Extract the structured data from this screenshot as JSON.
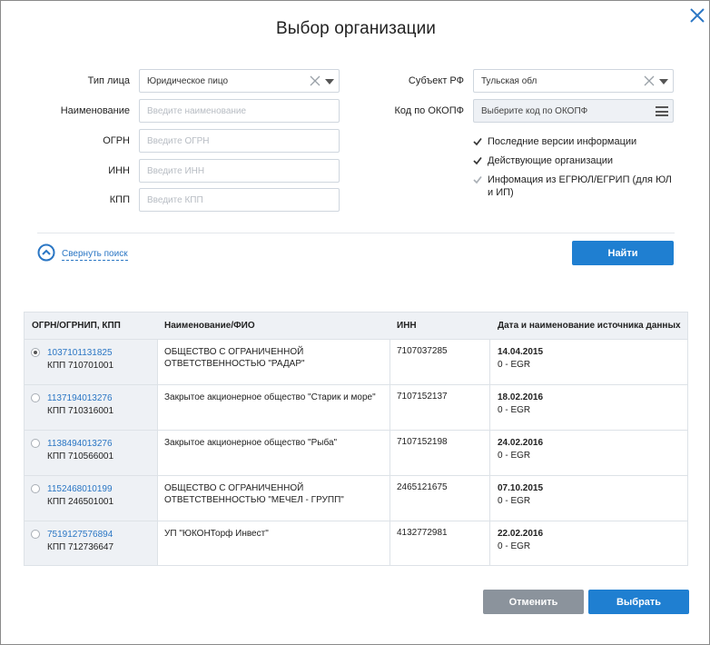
{
  "dialog": {
    "title": "Выбор организации"
  },
  "form": {
    "entity_type": {
      "label": "Тип лица",
      "value": "Юридическое пицо"
    },
    "name": {
      "label": "Наименование",
      "placeholder": "Введите наименование"
    },
    "ogrn": {
      "label": "ОГРН",
      "placeholder": "Введите ОГРН"
    },
    "inn": {
      "label": "ИНН",
      "placeholder": "Введите ИНН"
    },
    "kpp": {
      "label": "КПП",
      "placeholder": "Введите КПП"
    },
    "region": {
      "label": "Субъект РФ",
      "value": "Тульская обл"
    },
    "okopf": {
      "label": "Код по ОКОПФ",
      "placeholder": "Выберите код по ОКОПФ"
    },
    "checkboxes": [
      {
        "label": "Последние версии информации",
        "checked": true,
        "disabled": false
      },
      {
        "label": "Действующие организации",
        "checked": true,
        "disabled": false
      },
      {
        "label": "Инфомация из ЕГРЮЛ/ЕГРИП (для ЮЛ и ИП)",
        "checked": true,
        "disabled": true
      }
    ]
  },
  "actions": {
    "collapse_label": "Свернуть поиск",
    "find_label": "Найти",
    "cancel_label": "Отменить",
    "select_label": "Выбрать"
  },
  "table": {
    "headers": [
      "ОГРН/ОГРНИП, КПП",
      "Наименование/ФИО",
      "ИНН",
      "Дата и наименование источника данных"
    ],
    "rows": [
      {
        "ogrn": "1037101131825",
        "kpp": "КПП 710701001",
        "name": "ОБЩЕСТВО С ОГРАНИЧЕННОЙ ОТВЕТСТВЕННОСТЬЮ \"РАДАР\"",
        "inn": "7107037285",
        "date": "14.04.2015",
        "source": "0 - EGR",
        "selected": true
      },
      {
        "ogrn": "1137194013276",
        "kpp": "КПП 710316001",
        "name": "Закрытое акционерное общество \"Старик и море\"",
        "inn": "7107152137",
        "date": "18.02.2016",
        "source": "0 - EGR",
        "selected": false
      },
      {
        "ogrn": "1138494013276",
        "kpp": "КПП 710566001",
        "name": "Закрытое акционерное общество \"Рыба\"",
        "inn": "7107152198",
        "date": "24.02.2016",
        "source": "0 - EGR",
        "selected": false
      },
      {
        "ogrn": "1152468010199",
        "kpp": "КПП 246501001",
        "name": "ОБЩЕСТВО С ОГРАНИЧЕННОЙ ОТВЕТСТВЕННОСТЬЮ \"МЕЧЕЛ - ГРУПП\"",
        "inn": "2465121675",
        "date": "07.10.2015",
        "source": "0 - EGR",
        "selected": false
      },
      {
        "ogrn": "7519127576894",
        "kpp": "КПП 712736647",
        "name": "УП \"ЮКОНТорф Инвест\"",
        "inn": "4132772981",
        "date": "22.02.2016",
        "source": "0 - EGR",
        "selected": false
      }
    ]
  },
  "colors": {
    "primary": "#1f7fd1",
    "link": "#2a76c4",
    "secondary_button": "#8b939c",
    "header_bg": "#eef1f5"
  },
  "icons": [
    "close-icon",
    "clear-icon",
    "chevron-down-icon",
    "menu-icon",
    "checkbox-checked-icon",
    "chevron-up-circle-icon",
    "radio-icon"
  ]
}
